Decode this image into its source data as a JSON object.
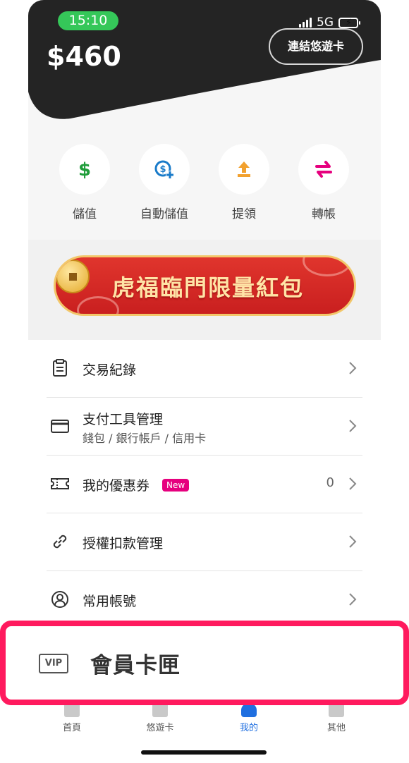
{
  "status_bar": {
    "time": "15:10",
    "network": "5G",
    "time_pill_color": "#35c759",
    "battery_color": "#35c759"
  },
  "wallet": {
    "balance": "$460",
    "link_card_button": "連結悠遊卡"
  },
  "actions": [
    {
      "label": "儲值",
      "icon": "dollar-icon",
      "color": "#1f9d3a"
    },
    {
      "label": "自動儲值",
      "icon": "auto-topup-icon",
      "color": "#1a7bc9"
    },
    {
      "label": "提領",
      "icon": "withdraw-icon",
      "color": "#f2a12e"
    },
    {
      "label": "轉帳",
      "icon": "transfer-icon",
      "color": "#e6007e"
    }
  ],
  "banner": {
    "text": "虎福臨門限量紅包"
  },
  "menu": [
    {
      "title": "交易紀錄",
      "icon": "clipboard-icon"
    },
    {
      "title": "支付工具管理",
      "subtitle": "錢包 / 銀行帳戶 / 信用卡",
      "icon": "credit-card-icon"
    },
    {
      "title": "我的優惠券",
      "badge": "New",
      "count": "0",
      "icon": "coupon-icon"
    },
    {
      "title": "授權扣款管理",
      "icon": "link-icon"
    },
    {
      "title": "常用帳號",
      "icon": "user-circle-icon"
    }
  ],
  "highlight": {
    "title": "會員卡匣",
    "icon_text": "VIP",
    "border_color": "#ff1a5e"
  },
  "bottom_nav": [
    {
      "label": "首頁",
      "icon": "home-icon"
    },
    {
      "label": "悠遊卡",
      "icon": "card-icon"
    },
    {
      "label": "我的",
      "icon": "profile-icon",
      "active": true
    },
    {
      "label": "其他",
      "icon": "grid-icon"
    }
  ],
  "accent_color": "#1f6fe0",
  "badge_color": "#e6007e"
}
